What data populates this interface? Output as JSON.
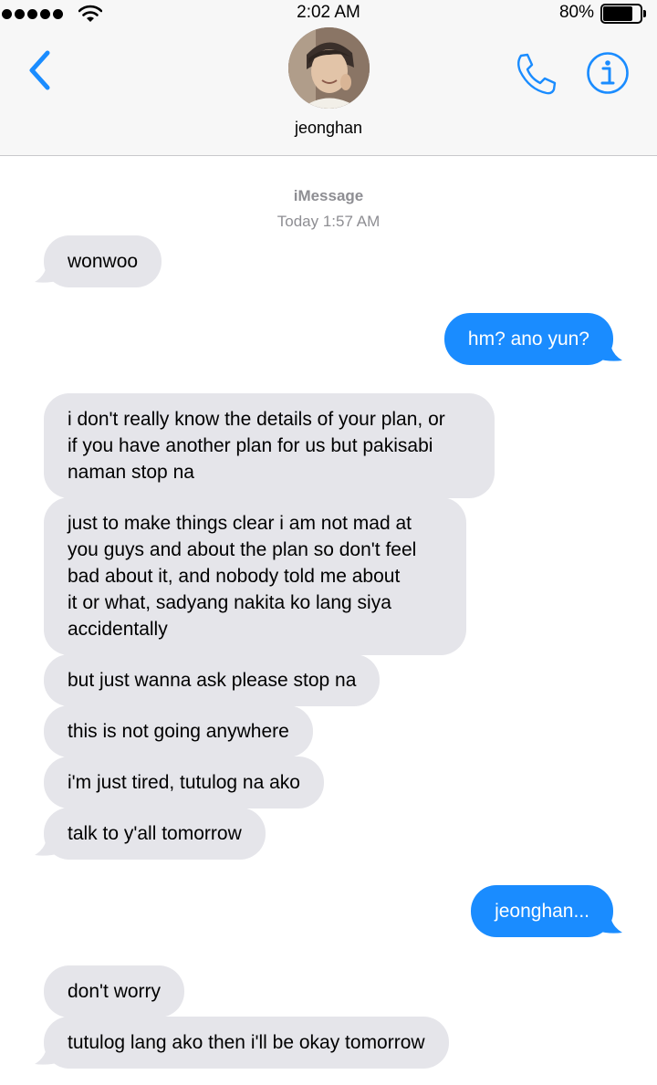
{
  "status_bar": {
    "time": "2:02 AM",
    "battery_percent": "80%",
    "battery_level": 0.8,
    "signal_icon": "signal-dots-icon",
    "wifi_icon": "wifi-icon"
  },
  "header": {
    "contact_name": "jeonghan",
    "back_icon": "chevron-left-icon",
    "call_icon": "phone-icon",
    "info_icon": "info-icon",
    "accent_color": "#1a8cff"
  },
  "thread": {
    "service_label": "iMessage",
    "timestamp": "Today 1:57 AM",
    "messages": [
      {
        "from": "them",
        "text": "wonwoo"
      },
      {
        "from": "me",
        "text": "hm? ano yun?"
      },
      {
        "from": "them",
        "text": "i don't really know the details of your plan, or\nif you have another plan for us but pakisabi\nnaman stop na"
      },
      {
        "from": "them",
        "text": "just to make things clear i am not mad at\nyou guys and about the plan so don't feel\nbad about it, and nobody told me about\nit or what, sadyang nakita ko lang siya\naccidentally"
      },
      {
        "from": "them",
        "text": "but just wanna ask please stop na"
      },
      {
        "from": "them",
        "text": "this is not going anywhere"
      },
      {
        "from": "them",
        "text": "i'm just tired, tutulog na ako"
      },
      {
        "from": "them",
        "text": "talk to y'all tomorrow"
      },
      {
        "from": "me",
        "text": "jeonghan..."
      },
      {
        "from": "them",
        "text": "don't worry"
      },
      {
        "from": "them",
        "text": "tutulog lang ako then i'll be okay tomorrow"
      }
    ],
    "incoming_color": "#e5e5ea",
    "outgoing_color": "#1a8cff"
  }
}
